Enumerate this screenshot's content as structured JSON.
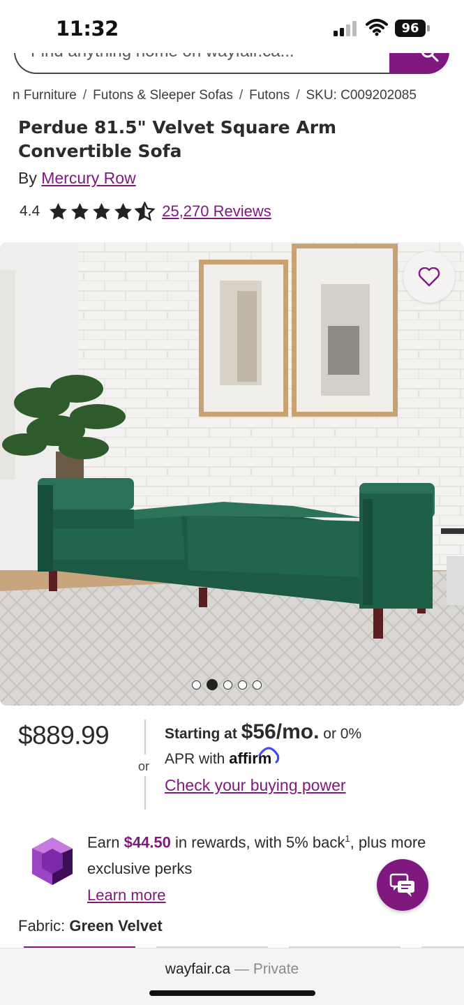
{
  "status_bar": {
    "time": "11:32",
    "battery": "96"
  },
  "search": {
    "placeholder": "Find anything home on wayfair.ca..."
  },
  "breadcrumb": [
    "n Furniture",
    "Futons & Sleeper Sofas",
    "Futons",
    "SKU: C009202085"
  ],
  "product": {
    "title": "Perdue 81.5\" Velvet Square Arm Convertible Sofa",
    "by_prefix": "By",
    "brand": "Mercury Row",
    "rating": "4.4",
    "rating_value": 4.4,
    "rating_max": 5,
    "reviews": "25,270 Reviews"
  },
  "gallery": {
    "image_count": 5,
    "active_index": 1
  },
  "pricing": {
    "price": "$889.99",
    "or": "or",
    "starting_at": "Starting at",
    "monthly": "$56/mo.",
    "or_zero": "or 0%",
    "apr_with": "APR with",
    "affirm": "affirm",
    "check_power": "Check your buying power"
  },
  "rewards": {
    "earn": "Earn",
    "amount": "$44.50",
    "rest": "in rewards, with 5% back",
    "footnote": "1",
    "tail": ", plus more exclusive perks",
    "learn_more": "Learn more"
  },
  "fabric": {
    "label": "Fabric:",
    "value": "Green Velvet"
  },
  "browser": {
    "domain": "wayfair.ca",
    "separator": " — ",
    "mode": "Private"
  },
  "colors": {
    "brand_purple": "#7f187f",
    "sofa_green": "#1c5a45"
  },
  "icons": [
    "search-icon",
    "heart-icon",
    "chat-icon",
    "star-icon",
    "gem-icon",
    "wifi-icon",
    "signal-icon"
  ]
}
